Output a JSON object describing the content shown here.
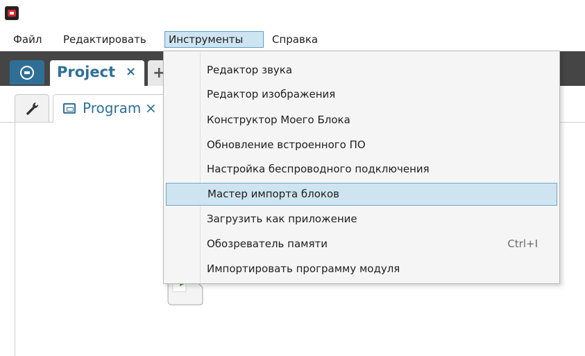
{
  "menubar": {
    "file": "Файл",
    "edit": "Редактировать",
    "tools": "Инструменты",
    "help": "Справка"
  },
  "tabs": {
    "project_label": "Project",
    "project_close": "×",
    "add": "+"
  },
  "subtabs": {
    "program_label": "Program",
    "program_close": "×"
  },
  "tools_menu": {
    "items": [
      {
        "label": "Редактор звука",
        "shortcut": ""
      },
      {
        "label": "Редактор изображения",
        "shortcut": ""
      },
      {
        "label": "Конструктор Моего Блока",
        "shortcut": ""
      },
      {
        "label": "Обновление встроенного ПО",
        "shortcut": ""
      },
      {
        "label": "Настройка беспроводного подключения",
        "shortcut": ""
      },
      {
        "label": "Мастер импорта блоков",
        "shortcut": "",
        "highlighted": true
      },
      {
        "label": "Загрузить как приложение",
        "shortcut": ""
      },
      {
        "label": "Обозреватель памяти",
        "shortcut": "Ctrl+I"
      },
      {
        "label": "Импортировать программу модуля",
        "shortcut": ""
      }
    ]
  },
  "icons": {
    "app": "app-logo-icon",
    "home": "lobby-icon",
    "wrench": "wrench-icon",
    "program": "program-icon",
    "start": "play-icon"
  },
  "colors": {
    "accent": "#2f6f97",
    "menu_highlight": "#cfe4f1",
    "tab_bar": "#454545",
    "start_green": "#3aa53a",
    "start_orange": "#f39a2a"
  }
}
